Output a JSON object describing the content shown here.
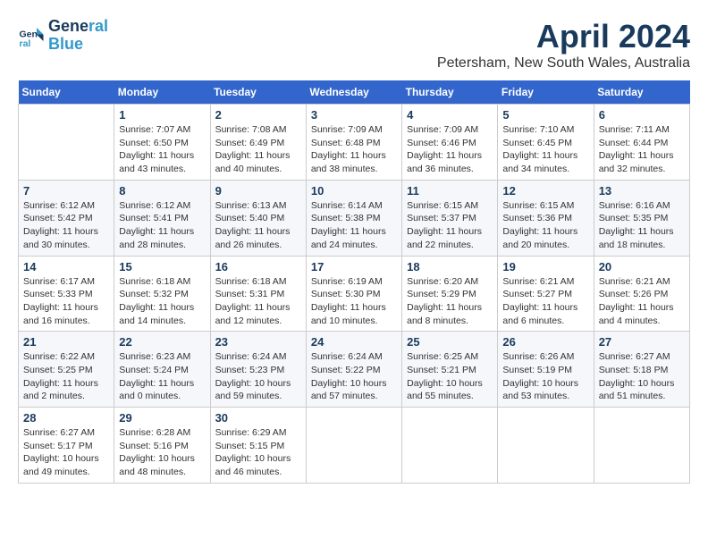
{
  "header": {
    "logo_line1": "General",
    "logo_line2": "Blue",
    "month": "April 2024",
    "location": "Petersham, New South Wales, Australia"
  },
  "days_of_week": [
    "Sunday",
    "Monday",
    "Tuesday",
    "Wednesday",
    "Thursday",
    "Friday",
    "Saturday"
  ],
  "weeks": [
    [
      {
        "day": "",
        "info": ""
      },
      {
        "day": "1",
        "info": "Sunrise: 7:07 AM\nSunset: 6:50 PM\nDaylight: 11 hours\nand 43 minutes."
      },
      {
        "day": "2",
        "info": "Sunrise: 7:08 AM\nSunset: 6:49 PM\nDaylight: 11 hours\nand 40 minutes."
      },
      {
        "day": "3",
        "info": "Sunrise: 7:09 AM\nSunset: 6:48 PM\nDaylight: 11 hours\nand 38 minutes."
      },
      {
        "day": "4",
        "info": "Sunrise: 7:09 AM\nSunset: 6:46 PM\nDaylight: 11 hours\nand 36 minutes."
      },
      {
        "day": "5",
        "info": "Sunrise: 7:10 AM\nSunset: 6:45 PM\nDaylight: 11 hours\nand 34 minutes."
      },
      {
        "day": "6",
        "info": "Sunrise: 7:11 AM\nSunset: 6:44 PM\nDaylight: 11 hours\nand 32 minutes."
      }
    ],
    [
      {
        "day": "7",
        "info": "Sunrise: 6:12 AM\nSunset: 5:42 PM\nDaylight: 11 hours\nand 30 minutes."
      },
      {
        "day": "8",
        "info": "Sunrise: 6:12 AM\nSunset: 5:41 PM\nDaylight: 11 hours\nand 28 minutes."
      },
      {
        "day": "9",
        "info": "Sunrise: 6:13 AM\nSunset: 5:40 PM\nDaylight: 11 hours\nand 26 minutes."
      },
      {
        "day": "10",
        "info": "Sunrise: 6:14 AM\nSunset: 5:38 PM\nDaylight: 11 hours\nand 24 minutes."
      },
      {
        "day": "11",
        "info": "Sunrise: 6:15 AM\nSunset: 5:37 PM\nDaylight: 11 hours\nand 22 minutes."
      },
      {
        "day": "12",
        "info": "Sunrise: 6:15 AM\nSunset: 5:36 PM\nDaylight: 11 hours\nand 20 minutes."
      },
      {
        "day": "13",
        "info": "Sunrise: 6:16 AM\nSunset: 5:35 PM\nDaylight: 11 hours\nand 18 minutes."
      }
    ],
    [
      {
        "day": "14",
        "info": "Sunrise: 6:17 AM\nSunset: 5:33 PM\nDaylight: 11 hours\nand 16 minutes."
      },
      {
        "day": "15",
        "info": "Sunrise: 6:18 AM\nSunset: 5:32 PM\nDaylight: 11 hours\nand 14 minutes."
      },
      {
        "day": "16",
        "info": "Sunrise: 6:18 AM\nSunset: 5:31 PM\nDaylight: 11 hours\nand 12 minutes."
      },
      {
        "day": "17",
        "info": "Sunrise: 6:19 AM\nSunset: 5:30 PM\nDaylight: 11 hours\nand 10 minutes."
      },
      {
        "day": "18",
        "info": "Sunrise: 6:20 AM\nSunset: 5:29 PM\nDaylight: 11 hours\nand 8 minutes."
      },
      {
        "day": "19",
        "info": "Sunrise: 6:21 AM\nSunset: 5:27 PM\nDaylight: 11 hours\nand 6 minutes."
      },
      {
        "day": "20",
        "info": "Sunrise: 6:21 AM\nSunset: 5:26 PM\nDaylight: 11 hours\nand 4 minutes."
      }
    ],
    [
      {
        "day": "21",
        "info": "Sunrise: 6:22 AM\nSunset: 5:25 PM\nDaylight: 11 hours\nand 2 minutes."
      },
      {
        "day": "22",
        "info": "Sunrise: 6:23 AM\nSunset: 5:24 PM\nDaylight: 11 hours\nand 0 minutes."
      },
      {
        "day": "23",
        "info": "Sunrise: 6:24 AM\nSunset: 5:23 PM\nDaylight: 10 hours\nand 59 minutes."
      },
      {
        "day": "24",
        "info": "Sunrise: 6:24 AM\nSunset: 5:22 PM\nDaylight: 10 hours\nand 57 minutes."
      },
      {
        "day": "25",
        "info": "Sunrise: 6:25 AM\nSunset: 5:21 PM\nDaylight: 10 hours\nand 55 minutes."
      },
      {
        "day": "26",
        "info": "Sunrise: 6:26 AM\nSunset: 5:19 PM\nDaylight: 10 hours\nand 53 minutes."
      },
      {
        "day": "27",
        "info": "Sunrise: 6:27 AM\nSunset: 5:18 PM\nDaylight: 10 hours\nand 51 minutes."
      }
    ],
    [
      {
        "day": "28",
        "info": "Sunrise: 6:27 AM\nSunset: 5:17 PM\nDaylight: 10 hours\nand 49 minutes."
      },
      {
        "day": "29",
        "info": "Sunrise: 6:28 AM\nSunset: 5:16 PM\nDaylight: 10 hours\nand 48 minutes."
      },
      {
        "day": "30",
        "info": "Sunrise: 6:29 AM\nSunset: 5:15 PM\nDaylight: 10 hours\nand 46 minutes."
      },
      {
        "day": "",
        "info": ""
      },
      {
        "day": "",
        "info": ""
      },
      {
        "day": "",
        "info": ""
      },
      {
        "day": "",
        "info": ""
      }
    ]
  ]
}
